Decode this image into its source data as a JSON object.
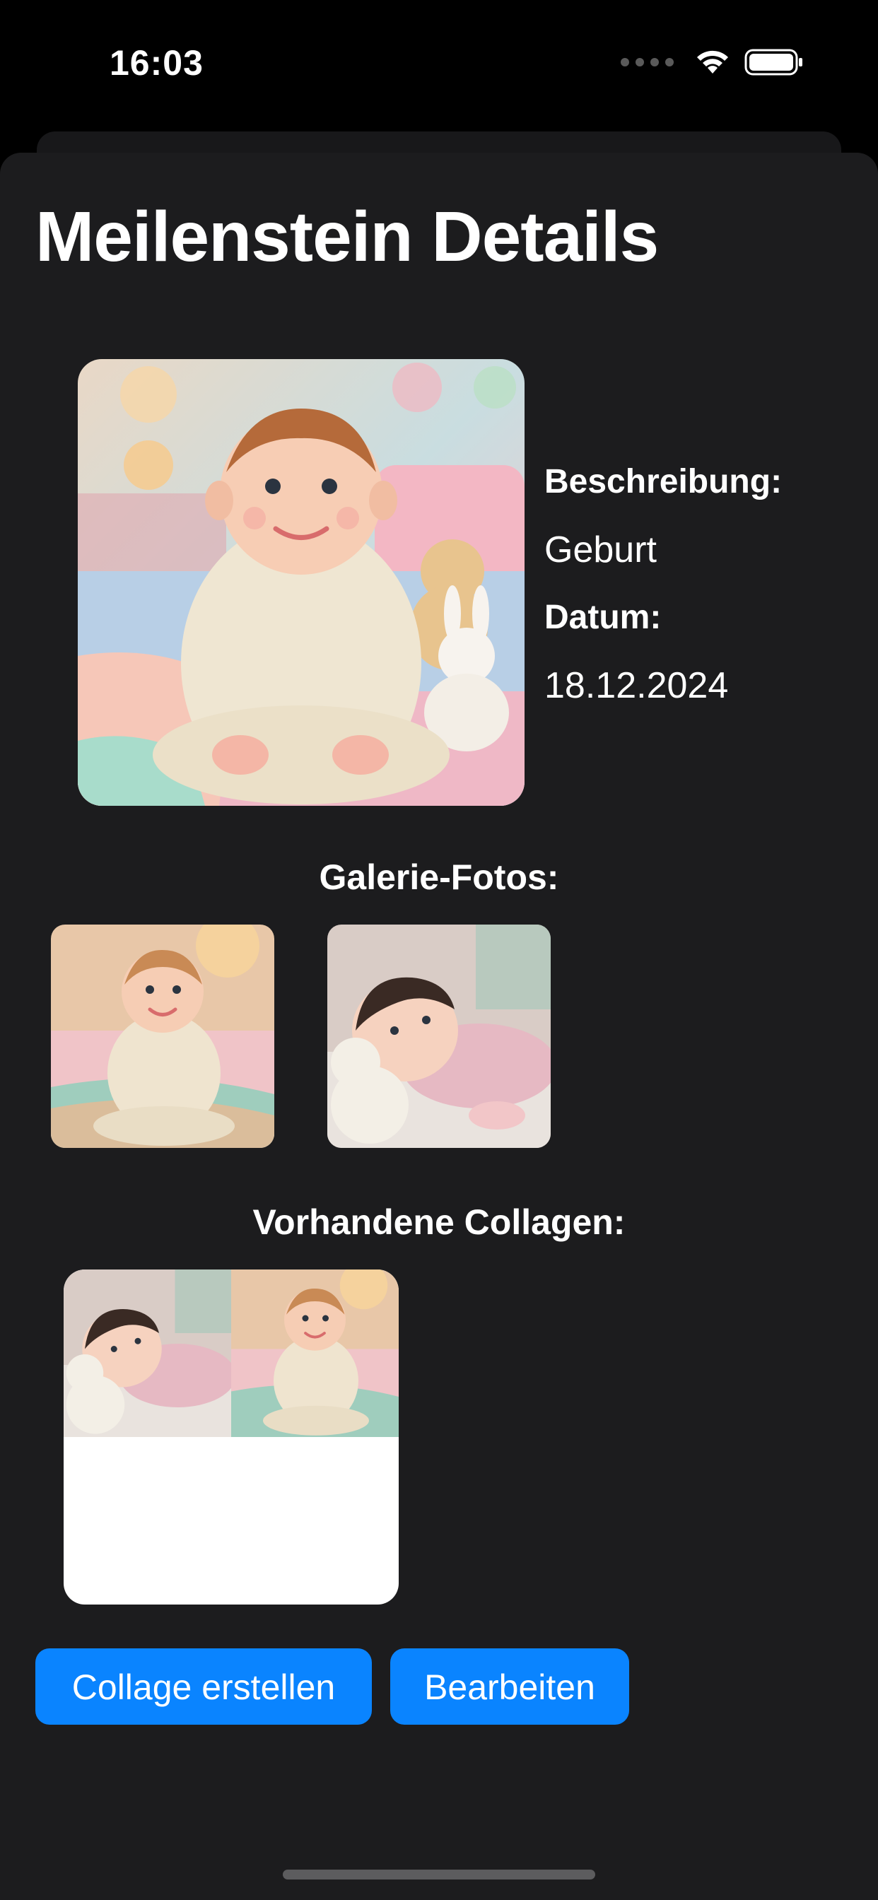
{
  "status_bar": {
    "time": "16:03"
  },
  "page": {
    "title": "Meilenstein Details",
    "description_label": "Beschreibung:",
    "description_value": "Geburt",
    "date_label": "Datum:",
    "date_value": "18.12.2024",
    "gallery_title": "Galerie-Fotos:",
    "collages_title": "Vorhandene Collagen:"
  },
  "buttons": {
    "create_collage": "Collage erstellen",
    "edit": "Bearbeiten"
  },
  "colors": {
    "background": "#1c1c1e",
    "accent": "#0a84ff",
    "text": "#ffffff"
  }
}
